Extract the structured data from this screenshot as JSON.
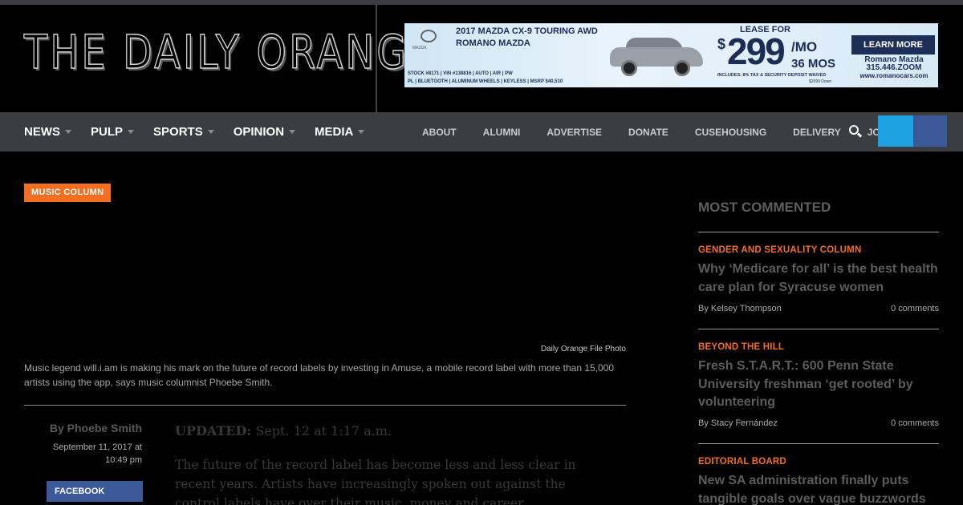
{
  "header": {
    "logo": "THE DAILY ORANGE"
  },
  "ad": {
    "brand": "MAZDA",
    "title1": "2017 MAZDA CX-9 TOURING AWD",
    "title2": "ROMANO MAZDA",
    "lease": "LEASE FOR",
    "dollar": "$",
    "price": "299",
    "per": "/MO",
    "term": "36 MOS",
    "includes": "INCLUDES: 8% TAX & SECURITY DEPOSIT WAIVED",
    "down": "$2999 Down",
    "stock": "STOCK #8171 | VIN #138816 | AUTO | AIR | PW",
    "specs": "PL | BLUETOOTH | ALUMINUM WHEELS | KEYLESS | MSRP $40,510",
    "cta": "LEARN MORE",
    "dealer_name": "Romano Mazda",
    "dealer_phone": "315.446.ZOOM",
    "dealer_site": "www.romanocars.com",
    "accent": "#1d2e57"
  },
  "nav": {
    "main": [
      {
        "label": "NEWS"
      },
      {
        "label": "PULP"
      },
      {
        "label": "SPORTS"
      },
      {
        "label": "OPINION"
      },
      {
        "label": "MEDIA"
      }
    ],
    "secondary": [
      {
        "label": "ABOUT"
      },
      {
        "label": "ALUMNI"
      },
      {
        "label": "ADVERTISE"
      },
      {
        "label": "DONATE"
      },
      {
        "label": "CUSEHOUSING"
      },
      {
        "label": "DELIVERY"
      },
      {
        "label": "JOBS"
      }
    ],
    "icons": {
      "search": "search-icon",
      "twitter": "twitter-icon",
      "facebook": "facebook-icon"
    },
    "colors": {
      "twitter": "#1da1e0",
      "facebook": "#3b5899"
    }
  },
  "article": {
    "tag": "MUSIC COLUMN",
    "photo_credit": "Daily Orange File Photo",
    "caption": "Music legend will.i.am is making his mark on the future of record labels by investing in Amuse, a mobile record label with more than 15,000 artists using the app, says music columnist Phoebe Smith.",
    "byline": "By Phoebe Smith",
    "date": "September 11, 2017 at 10:49 pm",
    "share_facebook": "FACEBOOK",
    "updated_label": "UPDATED:",
    "updated_value": "Sept. 12 at 1:17 a.m.",
    "body": "The future of the record label has become less and less clear in recent years. Artists have increasingly spoken out against the control labels have over their music, money and career.",
    "accent": "#f36e21"
  },
  "sidebar": {
    "title": "MOST COMMENTED",
    "items": [
      {
        "category": "GENDER AND SEXUALITY COLUMN",
        "headline": "Why ‘Medicare for all’ is the best health care plan for Syracuse women",
        "author": "By Kelsey Thompson",
        "comments": "0 comments"
      },
      {
        "category": "BEYOND THE HILL",
        "headline": "Fresh S.T.A.R.T.: 600 Penn State University freshman ‘get rooted’ by volunteering",
        "author": "By Stacy Fernández",
        "comments": "0 comments"
      },
      {
        "category": "EDITORIAL BOARD",
        "headline": "New SA administration finally puts tangible goals over vague buzzwords"
      }
    ]
  }
}
